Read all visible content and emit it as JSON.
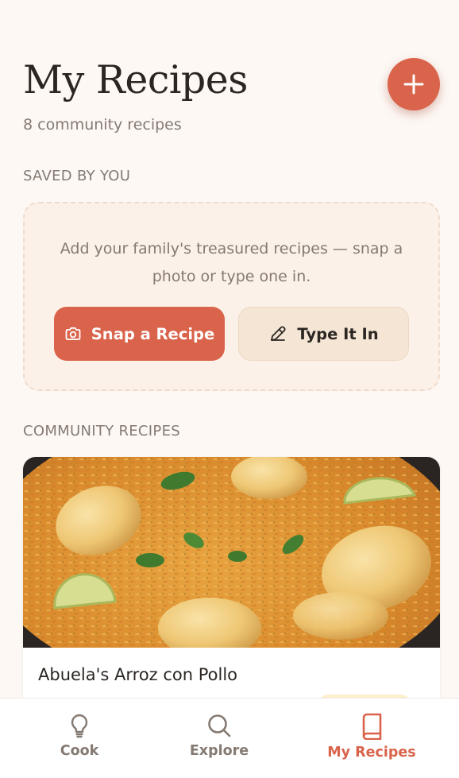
{
  "header": {
    "title": "My Recipes",
    "subtitle": "8 community recipes",
    "add_button_icon": "plus-icon"
  },
  "saved_section": {
    "label": "SAVED BY YOU",
    "empty_text": "Add your family's treasured recipes — snap a photo or type one in.",
    "snap_button": {
      "label": "Snap a Recipe",
      "icon": "camera-icon"
    },
    "type_button": {
      "label": "Type It In",
      "icon": "pencil-icon"
    }
  },
  "community_section": {
    "label": "COMMUNITY RECIPES",
    "recipes": [
      {
        "title": "Abuela's Arroz con Pollo"
      }
    ]
  },
  "bottom_nav": {
    "items": [
      {
        "label": "Cook",
        "icon": "lightbulb-icon",
        "active": false
      },
      {
        "label": "Explore",
        "icon": "search-icon",
        "active": false
      },
      {
        "label": "My Recipes",
        "icon": "book-icon",
        "active": true
      }
    ]
  },
  "colors": {
    "accent": "#d9634b",
    "background": "#fdf8f4",
    "muted_text": "#857a72",
    "soft_button": "#f4e5d4"
  }
}
